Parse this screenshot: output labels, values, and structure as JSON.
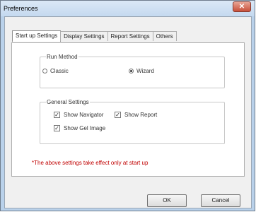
{
  "window": {
    "title": "Preferences",
    "close_symbol": "✕"
  },
  "tabs": [
    {
      "label": "Start up Settings"
    },
    {
      "label": "Display Settings"
    },
    {
      "label": "Report Settings"
    },
    {
      "label": "Others"
    }
  ],
  "run_method": {
    "legend": "Run Method",
    "options": [
      {
        "label": "Classic",
        "selected": false
      },
      {
        "label": "Wizard",
        "selected": true
      }
    ]
  },
  "general_settings": {
    "legend": "General Settings",
    "options": [
      {
        "label": "Show Navigator",
        "checked": true
      },
      {
        "label": "Show Report",
        "checked": true
      },
      {
        "label": "Show Gel Image",
        "checked": true
      }
    ]
  },
  "note": "*The above settings take effect only at start up",
  "buttons": {
    "ok": "OK",
    "cancel": "Cancel"
  },
  "check_mark": "✓",
  "colors": {
    "note_text": "#c00000",
    "titlebar": "#c4d9ef",
    "close_button": "#c8503a"
  }
}
